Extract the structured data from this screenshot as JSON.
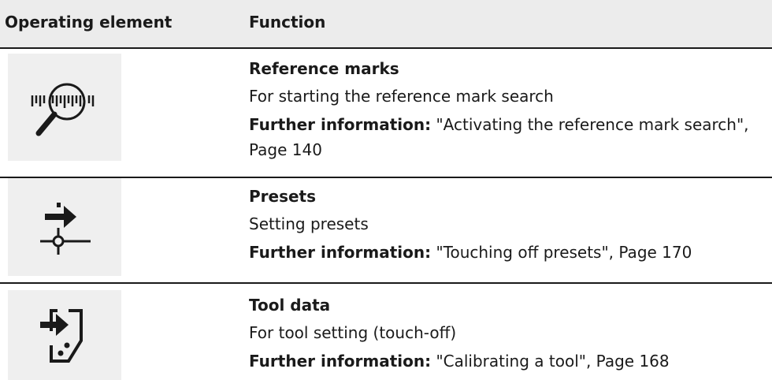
{
  "header": {
    "col1": "Operating element",
    "col2": "Function"
  },
  "rows": [
    {
      "icon": "reference-mark-search-icon",
      "title": "Reference marks",
      "desc": "For starting the reference mark search",
      "info_label": "Further information:",
      "info_text": " \"Activating the reference mark search\", Page 140"
    },
    {
      "icon": "presets-icon",
      "title": "Presets",
      "desc": "Setting presets",
      "info_label": "Further information:",
      "info_text": " \"Touching off presets\", Page 170"
    },
    {
      "icon": "tool-data-icon",
      "title": "Tool data",
      "desc": "For tool setting (touch-off)",
      "info_label": "Further information:",
      "info_text": " \"Calibrating a tool\", Page 168"
    }
  ]
}
